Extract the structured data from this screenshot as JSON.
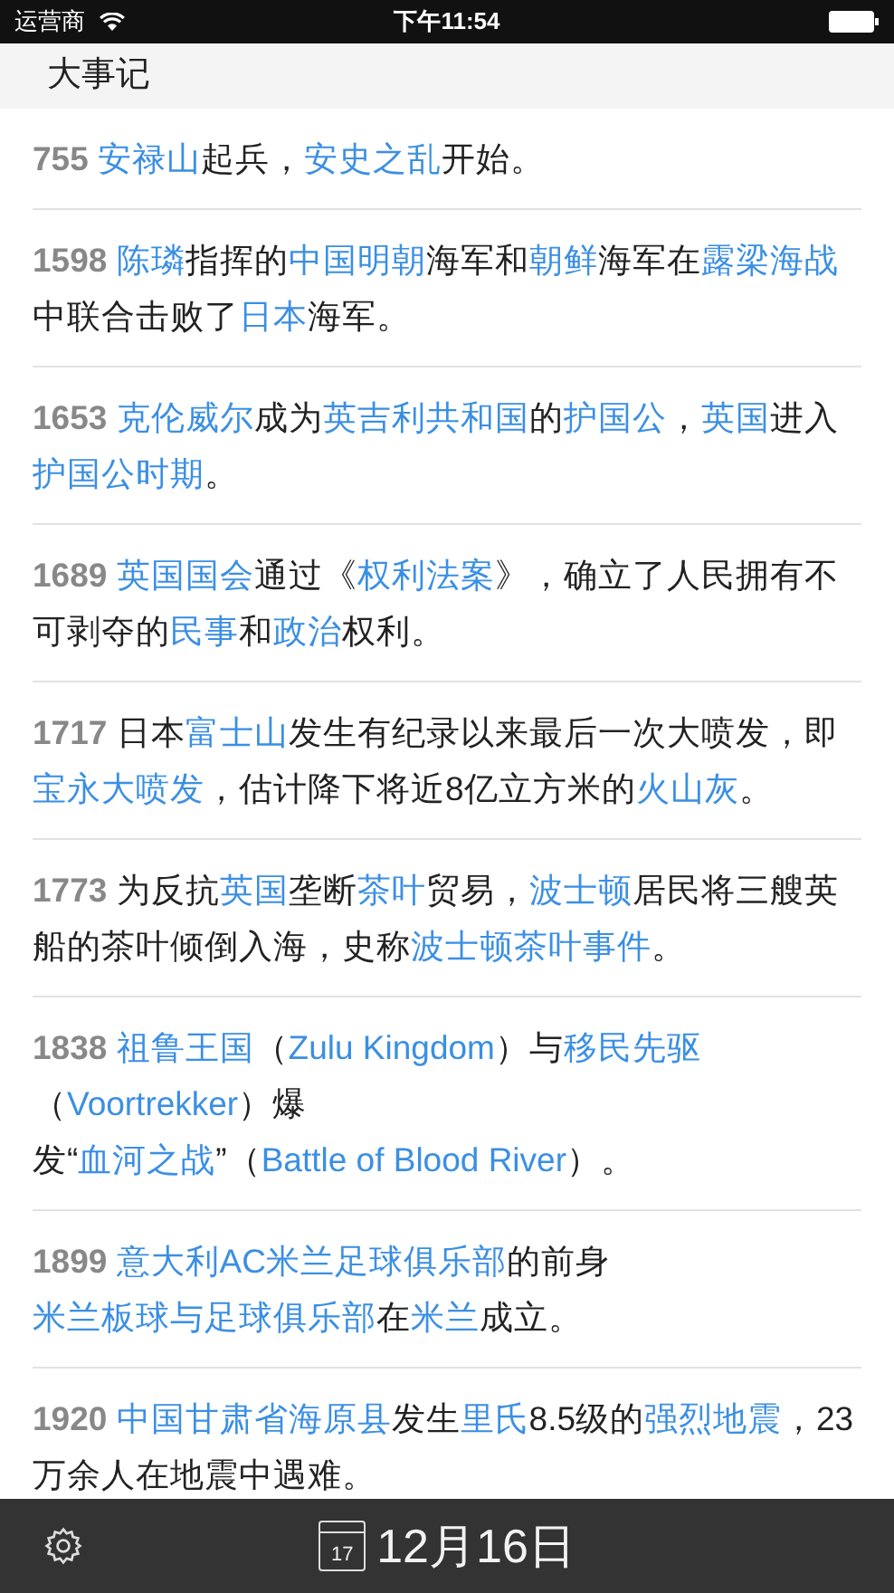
{
  "status_bar": {
    "carrier": "运营商",
    "time": "下午11:54"
  },
  "header": {
    "title": "大事记"
  },
  "events": [
    {
      "year": "755",
      "parts": [
        {
          "kind": "link",
          "text": "安禄山"
        },
        {
          "kind": "text",
          "text": "起兵，"
        },
        {
          "kind": "link",
          "text": "安史之乱"
        },
        {
          "kind": "text",
          "text": "开始。"
        }
      ]
    },
    {
      "year": "1598",
      "parts": [
        {
          "kind": "link",
          "text": "陈璘"
        },
        {
          "kind": "text",
          "text": "指挥的"
        },
        {
          "kind": "link",
          "text": "中国明朝"
        },
        {
          "kind": "text",
          "text": "海军和"
        },
        {
          "kind": "link",
          "text": "朝鲜"
        },
        {
          "kind": "text",
          "text": "海军在"
        },
        {
          "kind": "link",
          "text": "露梁海战"
        },
        {
          "kind": "text",
          "text": "中联合击败了"
        },
        {
          "kind": "link",
          "text": "日本"
        },
        {
          "kind": "text",
          "text": "海军。"
        }
      ]
    },
    {
      "year": "1653",
      "parts": [
        {
          "kind": "link",
          "text": "克伦威尔"
        },
        {
          "kind": "text",
          "text": "成为"
        },
        {
          "kind": "link",
          "text": "英吉利共和国"
        },
        {
          "kind": "text",
          "text": "的"
        },
        {
          "kind": "link",
          "text": "护国公"
        },
        {
          "kind": "text",
          "text": "，"
        },
        {
          "kind": "link",
          "text": "英国"
        },
        {
          "kind": "text",
          "text": "进入"
        },
        {
          "kind": "link",
          "text": "护国公时期"
        },
        {
          "kind": "text",
          "text": "。"
        }
      ]
    },
    {
      "year": "1689",
      "parts": [
        {
          "kind": "link",
          "text": "英国国会"
        },
        {
          "kind": "text",
          "text": "通过《"
        },
        {
          "kind": "link",
          "text": "权利法案"
        },
        {
          "kind": "text",
          "text": "》，确立了人民拥有不可剥夺的"
        },
        {
          "kind": "link",
          "text": "民事"
        },
        {
          "kind": "text",
          "text": "和"
        },
        {
          "kind": "link",
          "text": "政治"
        },
        {
          "kind": "text",
          "text": "权利。"
        }
      ]
    },
    {
      "year": "1717",
      "parts": [
        {
          "kind": "text",
          "text": "日本"
        },
        {
          "kind": "link",
          "text": "富士山"
        },
        {
          "kind": "text",
          "text": "发生有纪录以来最后一次大喷发，即"
        },
        {
          "kind": "link",
          "text": "宝永大喷发"
        },
        {
          "kind": "text",
          "text": "，估计降下将近8亿立方米的"
        },
        {
          "kind": "link",
          "text": "火山灰"
        },
        {
          "kind": "text",
          "text": "。"
        }
      ]
    },
    {
      "year": "1773",
      "parts": [
        {
          "kind": "text",
          "text": "为反抗"
        },
        {
          "kind": "link",
          "text": "英国"
        },
        {
          "kind": "text",
          "text": "垄断"
        },
        {
          "kind": "link",
          "text": "茶叶"
        },
        {
          "kind": "text",
          "text": "贸易，"
        },
        {
          "kind": "link",
          "text": "波士顿"
        },
        {
          "kind": "text",
          "text": "居民将三艘英船的茶叶倾倒入海，史称"
        },
        {
          "kind": "link",
          "text": "波士顿茶叶事件"
        },
        {
          "kind": "text",
          "text": "。"
        }
      ]
    },
    {
      "year": "1838",
      "parts": [
        {
          "kind": "link",
          "text": "祖鲁王国"
        },
        {
          "kind": "text",
          "text": "（"
        },
        {
          "kind": "link",
          "text": "Zulu Kingdom"
        },
        {
          "kind": "text",
          "text": "）与"
        },
        {
          "kind": "link",
          "text": "移民先驱"
        },
        {
          "kind": "text",
          "text": "（"
        },
        {
          "kind": "link",
          "text": "Voortrekker"
        },
        {
          "kind": "text",
          "text": "）爆发“"
        },
        {
          "kind": "link",
          "text": "血河之战"
        },
        {
          "kind": "text",
          "text": "”（"
        },
        {
          "kind": "link",
          "text": "Battle of Blood River"
        },
        {
          "kind": "text",
          "text": "）。"
        }
      ]
    },
    {
      "year": "1899",
      "parts": [
        {
          "kind": "link",
          "text": "意大利AC米兰足球俱乐部"
        },
        {
          "kind": "text",
          "text": "的前身"
        },
        {
          "kind": "link",
          "text": "米兰板球与足球俱乐部"
        },
        {
          "kind": "text",
          "text": "在"
        },
        {
          "kind": "link",
          "text": "米兰"
        },
        {
          "kind": "text",
          "text": "成立。"
        }
      ]
    },
    {
      "year": "1920",
      "parts": [
        {
          "kind": "link",
          "text": "中国甘肃省海原县"
        },
        {
          "kind": "text",
          "text": "发生"
        },
        {
          "kind": "link",
          "text": "里氏"
        },
        {
          "kind": "text",
          "text": "8.5级的"
        },
        {
          "kind": "link",
          "text": "强烈地震"
        },
        {
          "kind": "text",
          "text": "，23万余人在地震中遇难。"
        }
      ]
    }
  ],
  "bottom_bar": {
    "date": "12月16日",
    "calendar_day": "17"
  }
}
